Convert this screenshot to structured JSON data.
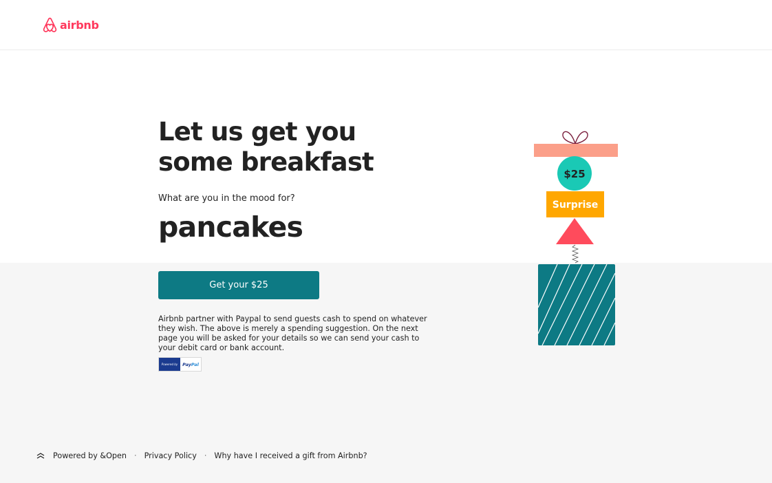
{
  "header": {
    "brand": "airbnb",
    "brand_color": "#ff385c"
  },
  "main": {
    "headline_line1": "Let us get you",
    "headline_line2": "some breakfast",
    "question": "What are you in the mood for?",
    "answer": "pancakes",
    "cta_label": "Get your $25",
    "disclaimer": "Airbnb partner with Paypal to send guests cash to spend on whatever they wish. The above is merely a spending suggestion. On the next page you will be asked for your details so we can send your cash to your debit card or bank account.",
    "paypal_badge": {
      "powered_by": "Powered by",
      "pay": "Pay",
      "pal": "Pal"
    }
  },
  "gift_illustration": {
    "amount_label": "$25",
    "surprise_label": "Surprise",
    "colors": {
      "ribbon": "#fb9f89",
      "coin": "#1ac9b5",
      "surprise": "#ffa700",
      "triangle": "#ff4b5c",
      "box": "#0d7a84"
    }
  },
  "footer": {
    "powered_by": "Powered by &Open",
    "separator": "·",
    "privacy": "Privacy Policy",
    "why": "Why have I received a gift from Airbnb?"
  },
  "colors": {
    "cta": "#0d7a84",
    "grey_band": "#f6f6f6",
    "text": "#222222"
  }
}
